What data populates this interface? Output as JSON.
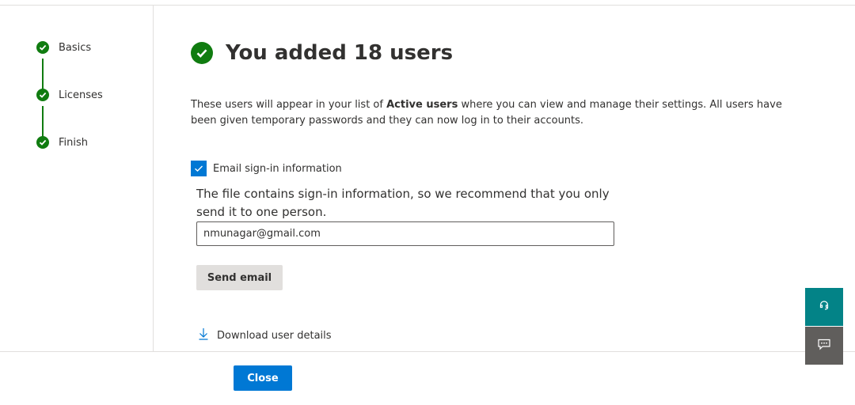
{
  "colors": {
    "success": "#107c10",
    "primary": "#0078d4",
    "help_button": "#038387",
    "feedback_button": "#605e5c"
  },
  "wizard": {
    "steps": [
      {
        "label": "Basics",
        "status": "complete"
      },
      {
        "label": "Licenses",
        "status": "complete"
      },
      {
        "label": "Finish",
        "status": "complete"
      }
    ]
  },
  "main": {
    "title": "You added 18 users",
    "description_pre": "These users will appear in your list of ",
    "description_bold": "Active users",
    "description_post": " where you can view and manage their settings. All users have been given temporary passwords and they can now log in to their accounts.",
    "email_checkbox": {
      "label": "Email sign-in information",
      "checked": true
    },
    "note": "The file contains sign-in information, so we recommend that you only send it to one person.",
    "email_input": {
      "value": "nmunagar@gmail.com"
    },
    "send_email_label": "Send email",
    "download_label": "Download user details"
  },
  "footer": {
    "close_label": "Close"
  },
  "floating": {
    "help_icon": "headset-icon",
    "feedback_icon": "chat-feedback-icon"
  }
}
